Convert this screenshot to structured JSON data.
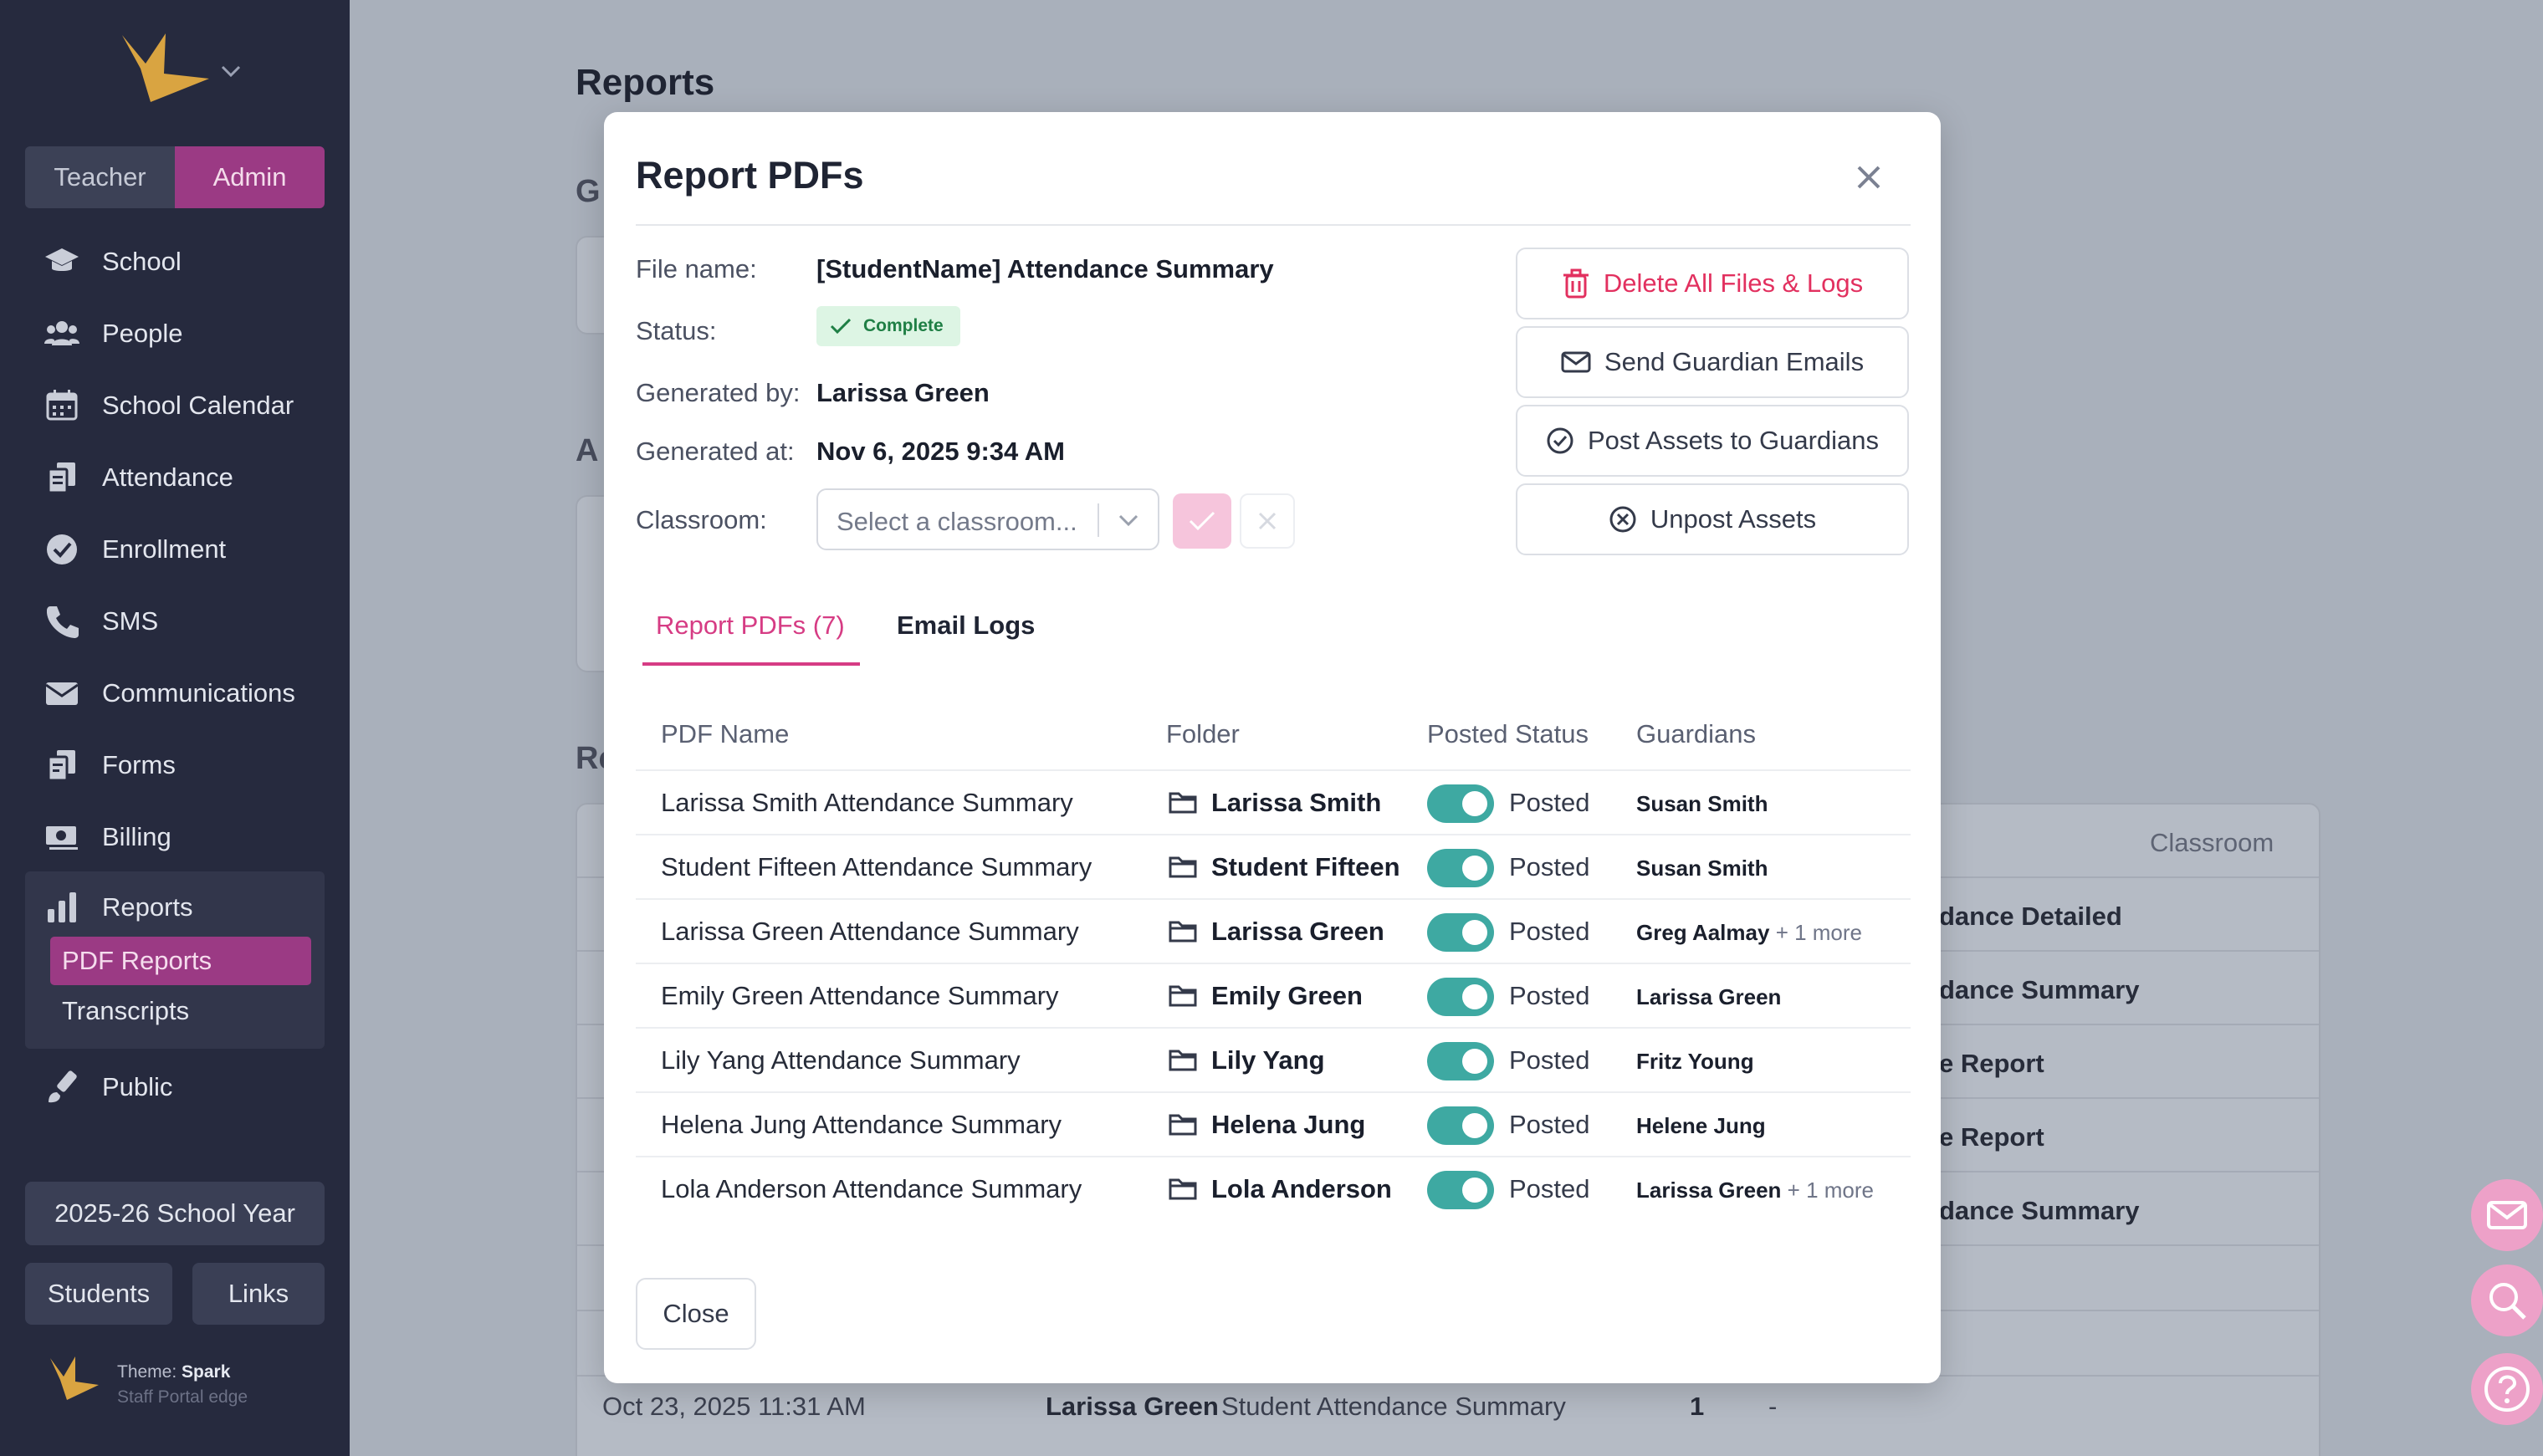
{
  "sidebar": {
    "role_teacher": "Teacher",
    "role_admin": "Admin",
    "items": [
      {
        "label": "School",
        "icon": "graduation-cap-icon"
      },
      {
        "label": "People",
        "icon": "people-icon"
      },
      {
        "label": "School Calendar",
        "icon": "calendar-icon"
      },
      {
        "label": "Attendance",
        "icon": "clipboard-icon"
      },
      {
        "label": "Enrollment",
        "icon": "badge-check-icon"
      },
      {
        "label": "SMS",
        "icon": "phone-icon"
      },
      {
        "label": "Communications",
        "icon": "envelope-icon"
      },
      {
        "label": "Forms",
        "icon": "forms-icon"
      }
    ],
    "billing": "Billing",
    "reports": "Reports",
    "sub_items": [
      "PDF Reports",
      "Transcripts"
    ],
    "public": "Public",
    "year": "2025-26 School Year",
    "students": "Students",
    "links": "Links",
    "theme_label": "Theme:",
    "theme_name": "Spark",
    "theme_sub": "Staff Portal edge"
  },
  "background": {
    "page_title": "Reports",
    "frag_1": "G",
    "frag_2": "A",
    "frag_3": "Re",
    "classroom_header": "Classroom",
    "cells": [
      "dance Detailed",
      "dance Summary",
      "e Report",
      "e Report",
      "dance Summary"
    ],
    "last_row": {
      "date": "Oct 23, 2025 11:31 AM",
      "name": "Larissa Green",
      "report": "Student Attendance Summary",
      "count": "1",
      "dash": "-"
    }
  },
  "modal": {
    "title": "Report PDFs",
    "labels": {
      "file_name": "File name:",
      "status": "Status:",
      "generated_by": "Generated by:",
      "generated_at": "Generated at:",
      "classroom": "Classroom:"
    },
    "file_name": "[StudentName] Attendance Summary",
    "status": "Complete",
    "generated_by": "Larissa Green",
    "generated_at": "Nov 6, 2025 9:34 AM",
    "classroom_placeholder": "Select a classroom...",
    "actions": {
      "delete": "Delete All Files & Logs",
      "send": "Send Guardian Emails",
      "post": "Post Assets to Guardians",
      "unpost": "Unpost Assets"
    },
    "tabs": {
      "pdfs": "Report PDFs (7)",
      "logs": "Email Logs"
    },
    "columns": {
      "pdf_name": "PDF Name",
      "folder": "Folder",
      "posted_status": "Posted Status",
      "guardians": "Guardians"
    },
    "rows": [
      {
        "pdf": "Larissa Smith Attendance Summary",
        "folder": "Larissa Smith",
        "posted": "Posted",
        "guardian": "Susan Smith",
        "more": ""
      },
      {
        "pdf": "Student Fifteen Attendance Summary",
        "folder": "Student Fifteen",
        "posted": "Posted",
        "guardian": "Susan Smith",
        "more": ""
      },
      {
        "pdf": "Larissa Green Attendance Summary",
        "folder": "Larissa Green",
        "posted": "Posted",
        "guardian": "Greg Aalmay",
        "more": "+ 1 more"
      },
      {
        "pdf": "Emily Green Attendance Summary",
        "folder": "Emily Green",
        "posted": "Posted",
        "guardian": "Larissa Green",
        "more": ""
      },
      {
        "pdf": "Lily Yang Attendance Summary",
        "folder": "Lily Yang",
        "posted": "Posted",
        "guardian": "Fritz Young",
        "more": ""
      },
      {
        "pdf": "Helena Jung Attendance Summary",
        "folder": "Helena Jung",
        "posted": "Posted",
        "guardian": "Helene Jung",
        "more": ""
      },
      {
        "pdf": "Lola Anderson Attendance Summary",
        "folder": "Lola Anderson",
        "posted": "Posted",
        "guardian": "Larissa Green",
        "more": "+ 1 more"
      }
    ],
    "close": "Close"
  },
  "colors": {
    "sidebar_bg": "#262a3e",
    "accent": "#9b3a84",
    "tab_accent": "#d63c84",
    "toggle_on": "#3ea9a2",
    "danger": "#e2305f"
  }
}
